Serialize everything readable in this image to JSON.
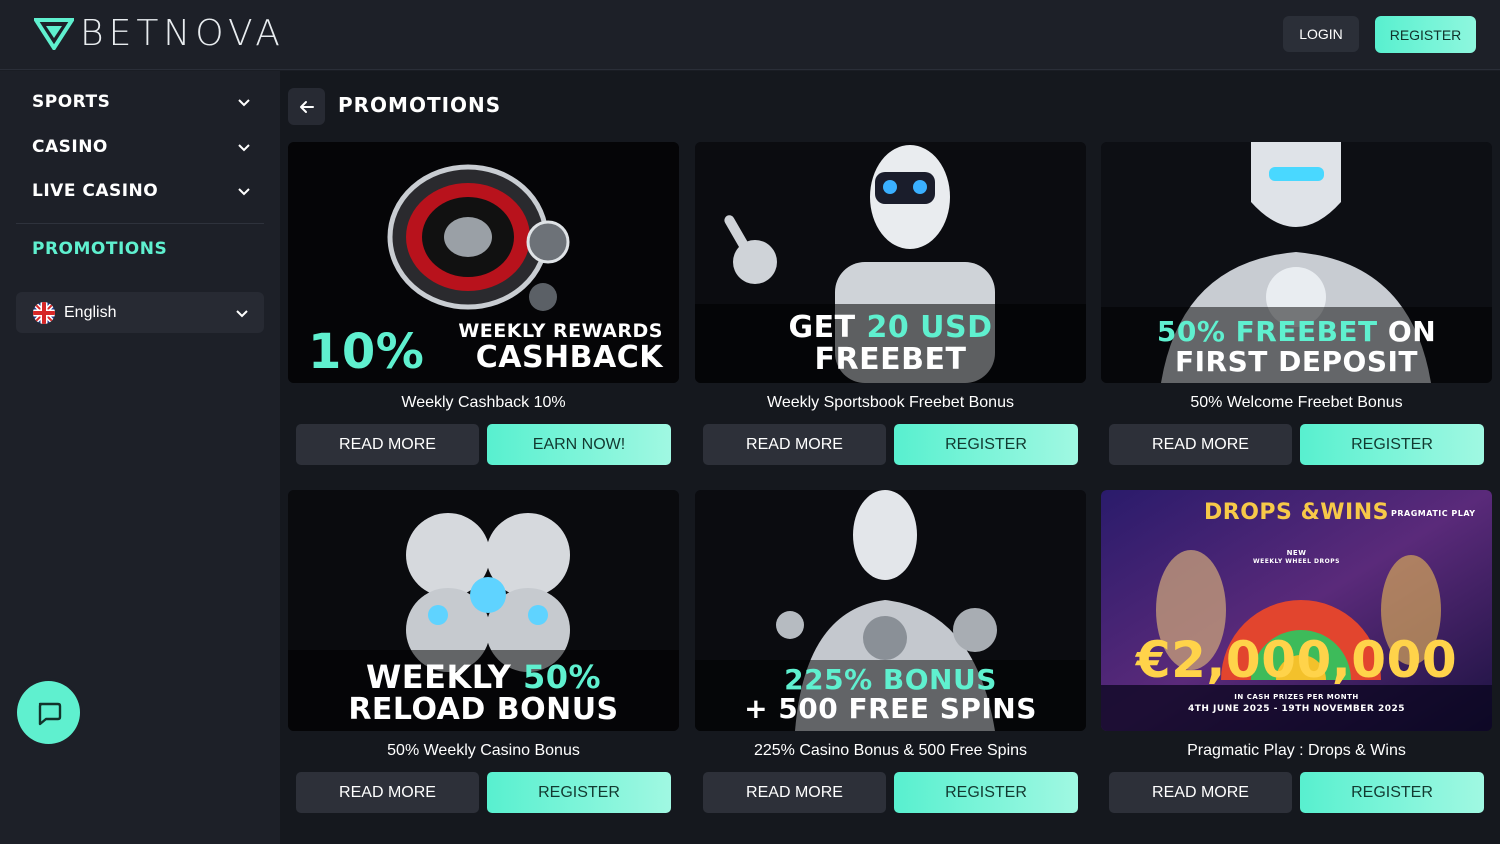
{
  "header": {
    "logo_text": "BETNOVA",
    "login_label": "LOGIN",
    "register_label": "REGISTER"
  },
  "sidebar": {
    "items": [
      {
        "label": "SPORTS",
        "icon": "chevron-down-icon"
      },
      {
        "label": "CASINO",
        "icon": "chevron-down-icon"
      },
      {
        "label": "LIVE CASINO",
        "icon": "chevron-down-icon"
      }
    ],
    "promotions_label": "PROMOTIONS",
    "language": {
      "label": "English",
      "flag": "uk-flag-icon"
    },
    "chat_icon": "chat-icon"
  },
  "main": {
    "title": "PROMOTIONS",
    "back_icon": "arrow-left-icon",
    "read_more_label": "READ MORE",
    "cards": [
      {
        "banner_pct": "10%",
        "banner_line1": "WEEKLY REWARDS",
        "banner_line2": "CASHBACK",
        "title": "Weekly Cashback 10%",
        "cta": "EARN NOW!"
      },
      {
        "banner_line1a": "GET ",
        "banner_line1b": "20 USD",
        "banner_line2": "FREEBET",
        "title": "Weekly Sportsbook Freebet Bonus",
        "cta": "REGISTER"
      },
      {
        "banner_line1a": "50% FREEBET",
        "banner_line1b": " ON",
        "banner_line2": "FIRST DEPOSIT",
        "title": "50% Welcome Freebet Bonus",
        "cta": "REGISTER"
      },
      {
        "banner_line1a": "WEEKLY ",
        "banner_line1b": "50%",
        "banner_line2": "RELOAD BONUS",
        "title": "50% Weekly Casino Bonus",
        "cta": "REGISTER"
      },
      {
        "banner_line1": "225% BONUS",
        "banner_line2": "+ 500 FREE SPINS",
        "title": "225% Casino Bonus & 500 Free Spins",
        "cta": "REGISTER"
      },
      {
        "banner_logo": "DROPS &WINS",
        "banner_amount": "€2,000,000",
        "banner_badge": "PRAGMATIC PLAY",
        "banner_new": "NEW",
        "banner_weekly": "WEEKLY WHEEL DROPS",
        "banner_prize": "IN CASH PRIZES PER MONTH",
        "banner_dates": "4TH JUNE 2025 - 19TH NOVEMBER 2025",
        "title": "Pragmatic Play : Drops & Wins",
        "cta": "REGISTER"
      }
    ]
  },
  "colors": {
    "accent": "#5ff0cf",
    "background": "#15181e",
    "sidebar": "#1d2028"
  }
}
